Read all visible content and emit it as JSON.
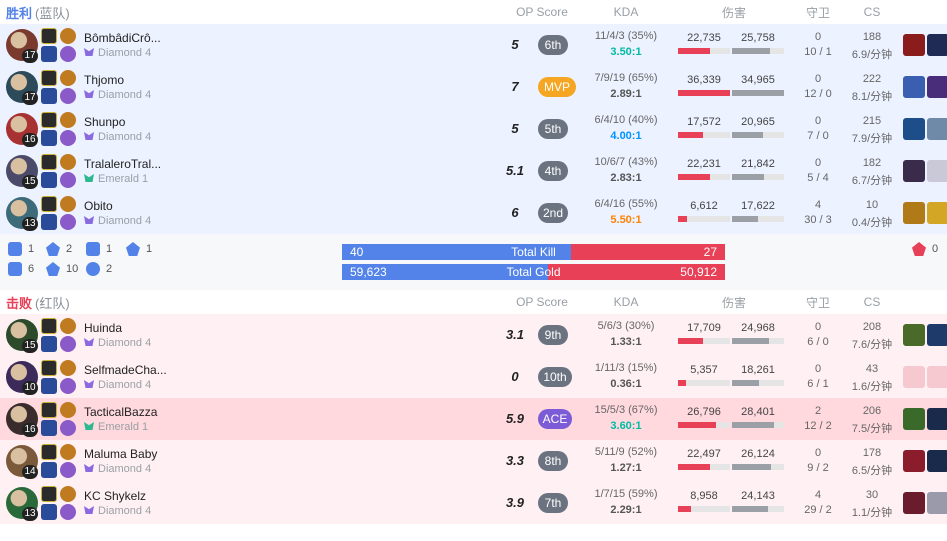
{
  "colors": {
    "blue": "#5383e8",
    "red": "#e84057",
    "bg_blue": "#ecf2ff",
    "bg_red": "#fff1f3",
    "highlight": "#ffd9de",
    "mvp": "#f5a623",
    "rank_badge": "#6b7380",
    "ace": "#7c5cd6",
    "kda_green": "#00bba3",
    "kda_blue": "#0093ff",
    "kda_orange": "#ff8200"
  },
  "blue_team": {
    "result": "胜利",
    "team": "(蓝队)",
    "headers": {
      "op": "OP Score",
      "kda": "KDA",
      "damage": "伤害",
      "ward": "守卫",
      "cs": "CS"
    },
    "players": [
      {
        "name": "BômbâdiCrô...",
        "rank": "Diamond 4",
        "tier": "diamond",
        "level": "17",
        "score": "5",
        "badge": "6th",
        "badge_type": "rank",
        "kda": "11/4/3 (35%)",
        "ratio": "3.50:1",
        "ratio_color": "green",
        "dmg_dealt": "22,735",
        "dmg_taken": "25,758",
        "dealt_pct": 0.62,
        "taken_pct": 0.74,
        "wards": "0",
        "ward_detail": "10 / 1",
        "cs": "188",
        "cs_min": "6.9/分钟",
        "champ_color": "#7a3b2e",
        "items": [
          "#8a1c1c",
          "#1f2a55"
        ]
      },
      {
        "name": "Thjomo",
        "rank": "Diamond 4",
        "tier": "diamond",
        "level": "17",
        "score": "7",
        "badge": "MVP",
        "badge_type": "mvp",
        "kda": "7/9/19 (65%)",
        "ratio": "2.89:1",
        "ratio_color": "plain",
        "dmg_dealt": "36,339",
        "dmg_taken": "34,965",
        "dealt_pct": 1.0,
        "taken_pct": 1.0,
        "wards": "0",
        "ward_detail": "12 / 0",
        "cs": "222",
        "cs_min": "8.1/分钟",
        "champ_color": "#2c4a5a",
        "items": [
          "#3a5fb0",
          "#4a2d7a"
        ]
      },
      {
        "name": "Shunpo",
        "rank": "Diamond 4",
        "tier": "diamond",
        "level": "16",
        "score": "5",
        "badge": "5th",
        "badge_type": "rank",
        "kda": "6/4/10 (40%)",
        "ratio": "4.00:1",
        "ratio_color": "blue",
        "dmg_dealt": "17,572",
        "dmg_taken": "20,965",
        "dealt_pct": 0.48,
        "taken_pct": 0.6,
        "wards": "0",
        "ward_detail": "7 / 0",
        "cs": "215",
        "cs_min": "7.9/分钟",
        "champ_color": "#a83232",
        "items": [
          "#1d4e89",
          "#6f8aa8"
        ]
      },
      {
        "name": "TralaleroTral...",
        "rank": "Emerald 1",
        "tier": "emerald",
        "level": "15",
        "score": "5.1",
        "badge": "4th",
        "badge_type": "rank",
        "kda": "10/6/7 (43%)",
        "ratio": "2.83:1",
        "ratio_color": "plain",
        "dmg_dealt": "22,231",
        "dmg_taken": "21,842",
        "dealt_pct": 0.61,
        "taken_pct": 0.62,
        "wards": "0",
        "ward_detail": "5 / 4",
        "cs": "182",
        "cs_min": "6.7/分钟",
        "champ_color": "#4b4a6a",
        "items": [
          "#3b2b4a",
          "#c9c9d8"
        ]
      },
      {
        "name": "Obito",
        "rank": "Diamond 4",
        "tier": "diamond",
        "level": "13",
        "score": "6",
        "badge": "2nd",
        "badge_type": "rank",
        "kda": "6/4/16 (55%)",
        "ratio": "5.50:1",
        "ratio_color": "orange",
        "dmg_dealt": "6,612",
        "dmg_taken": "17,622",
        "dealt_pct": 0.18,
        "taken_pct": 0.5,
        "wards": "4",
        "ward_detail": "30 / 3",
        "cs": "10",
        "cs_min": "0.4/分钟",
        "champ_color": "#3d6b7a",
        "items": [
          "#b07a18",
          "#d4a625"
        ]
      }
    ]
  },
  "summary": {
    "blue_objectives": [
      {
        "icon": "baron-icon",
        "count": "1"
      },
      {
        "icon": "dragon-icon",
        "count": "2"
      },
      {
        "icon": "herald-icon",
        "count": "1"
      },
      {
        "icon": "grub-icon",
        "count": "1"
      },
      {
        "icon": "tower-icon",
        "count": "6"
      },
      {
        "icon": "inhibitor-icon",
        "count": "10"
      },
      {
        "icon": "atakhan-icon",
        "count": "2"
      }
    ],
    "red_objectives": [
      {
        "icon": "tower-icon",
        "count": "0"
      }
    ],
    "kills": {
      "label": "Total Kill",
      "blue": "40",
      "red": "27",
      "blue_share": 0.597
    },
    "gold": {
      "label": "Total Gold",
      "blue": "59,623",
      "red": "50,912",
      "blue_share": 0.539
    }
  },
  "red_team": {
    "result": "击败",
    "team": "(红队)",
    "headers": {
      "op": "OP Score",
      "kda": "KDA",
      "damage": "伤害",
      "ward": "守卫",
      "cs": "CS"
    },
    "players": [
      {
        "name": "Huinda",
        "rank": "Diamond 4",
        "tier": "diamond",
        "level": "15",
        "score": "3.1",
        "badge": "9th",
        "badge_type": "rank",
        "kda": "5/6/3 (30%)",
        "ratio": "1.33:1",
        "ratio_color": "plain",
        "dmg_dealt": "17,709",
        "dmg_taken": "24,968",
        "dealt_pct": 0.49,
        "taken_pct": 0.71,
        "wards": "0",
        "ward_detail": "6 / 0",
        "cs": "208",
        "cs_min": "7.6/分钟",
        "champ_color": "#2d4a2a",
        "items": [
          "#4a6a2a",
          "#1d3a6a"
        ],
        "highlight": false
      },
      {
        "name": "SelfmadeCha...",
        "rank": "Diamond 4",
        "tier": "diamond",
        "level": "10",
        "score": "0",
        "badge": "10th",
        "badge_type": "rank",
        "kda": "1/11/3 (15%)",
        "ratio": "0.36:1",
        "ratio_color": "plain",
        "dmg_dealt": "5,357",
        "dmg_taken": "18,261",
        "dealt_pct": 0.15,
        "taken_pct": 0.52,
        "wards": "0",
        "ward_detail": "6 / 1",
        "cs": "43",
        "cs_min": "1.6/分钟",
        "champ_color": "#3b2a5a",
        "items": [
          "#f6c9d0",
          "#f6c9d0"
        ],
        "highlight": false
      },
      {
        "name": "TacticalBazza",
        "rank": "Emerald 1",
        "tier": "emerald",
        "level": "16",
        "score": "5.9",
        "badge": "ACE",
        "badge_type": "ace",
        "kda": "15/5/3 (67%)",
        "ratio": "3.60:1",
        "ratio_color": "green",
        "dmg_dealt": "26,796",
        "dmg_taken": "28,401",
        "dealt_pct": 0.74,
        "taken_pct": 0.81,
        "wards": "2",
        "ward_detail": "12 / 2",
        "cs": "206",
        "cs_min": "7.5/分钟",
        "champ_color": "#3a2c2c",
        "items": [
          "#3a6a2a",
          "#1a2a4a"
        ],
        "highlight": true
      },
      {
        "name": "Maluma Baby",
        "rank": "Diamond 4",
        "tier": "diamond",
        "level": "14",
        "score": "3.3",
        "badge": "8th",
        "badge_type": "rank",
        "kda": "5/11/9 (52%)",
        "ratio": "1.27:1",
        "ratio_color": "plain",
        "dmg_dealt": "22,497",
        "dmg_taken": "26,124",
        "dealt_pct": 0.62,
        "taken_pct": 0.75,
        "wards": "0",
        "ward_detail": "9 / 2",
        "cs": "178",
        "cs_min": "6.5/分钟",
        "champ_color": "#7a5a3a",
        "items": [
          "#8a1c2c",
          "#1a2a4a"
        ],
        "highlight": false
      },
      {
        "name": "KC Shykelz",
        "rank": "Diamond 4",
        "tier": "diamond",
        "level": "13",
        "score": "3.9",
        "badge": "7th",
        "badge_type": "rank",
        "kda": "1/7/15 (59%)",
        "ratio": "2.29:1",
        "ratio_color": "plain",
        "dmg_dealt": "8,958",
        "dmg_taken": "24,143",
        "dealt_pct": 0.25,
        "taken_pct": 0.69,
        "wards": "4",
        "ward_detail": "29 / 2",
        "cs": "30",
        "cs_min": "1.1/分钟",
        "champ_color": "#2a6a3a",
        "items": [
          "#6a1c2c",
          "#9a9aaa"
        ],
        "highlight": false
      }
    ]
  }
}
